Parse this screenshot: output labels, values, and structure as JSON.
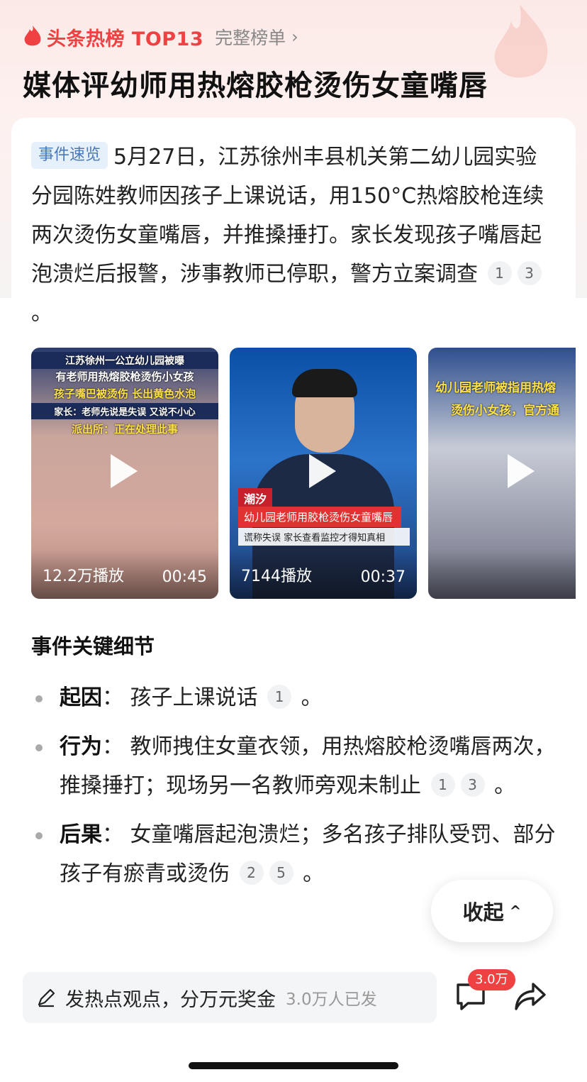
{
  "header": {
    "hot_title": "头条热榜 TOP13",
    "full_list": "完整榜单",
    "headline": "媒体评幼师用热熔胶枪烫伤女童嘴唇"
  },
  "summary": {
    "tag": "事件速览",
    "text": "5月27日，江苏徐州丰县机关第二幼儿园实验分园陈姓教师因孩子上课说话，用150°C热熔胶枪连续两次烫伤女童嘴唇，并推搡捶打。家长发现孩子嘴唇起泡溃烂后报警，涉事教师已停职，警方立案调查",
    "citations": [
      "1",
      "3"
    ],
    "end": "。"
  },
  "videos": [
    {
      "caption_lines": [
        "江苏徐州一公立幼儿园被曝",
        "有老师用热熔胶枪烫伤小女孩",
        "孩子嘴巴被烫伤 长出黄色水泡",
        "家长：老师先说是失误 又说不小心",
        "派出所：正在处理此事"
      ],
      "views": "12.2万播放",
      "duration": "00:45"
    },
    {
      "news_tag": "潮汐",
      "news_bar": "幼儿园老师用胶枪烫伤女童嘴唇",
      "news_sub": "谎称失误 家长查看监控才得知真相",
      "views": "7144播放",
      "duration": "00:37"
    },
    {
      "caption_lines": [
        "幼儿园老师被指用热熔",
        "烫伤小女孩，官方通"
      ],
      "views": "",
      "duration": ""
    }
  ],
  "section_title": "事件关键细节",
  "details": [
    {
      "label": "起因",
      "sep": "：",
      "text": "孩子上课说话",
      "citations": [
        "1"
      ],
      "end": "。"
    },
    {
      "label": "行为",
      "sep": "：",
      "text": "教师拽住女童衣领，用热熔胶枪烫嘴唇两次，推搡捶打；现场另一名教师旁观未制止",
      "citations": [
        "1",
        "3"
      ],
      "end": "。"
    },
    {
      "label": "后果",
      "sep": "：",
      "text": "女童嘴唇起泡溃烂；多名孩子排队受罚、部分孩子有瘀青或烫伤",
      "citations": [
        "2",
        "5"
      ],
      "end": "。"
    }
  ],
  "collapse_label": "收起",
  "bottom": {
    "post_text": "发热点观点，分万元奖金",
    "post_count": "3.0万人已发",
    "comment_badge": "3.0万"
  },
  "colors": {
    "accent": "#f04142",
    "tag_bg": "#e6f0fb",
    "tag_text": "#4a79b8"
  },
  "icons": [
    "flame-icon",
    "chevron-right-icon",
    "play-icon",
    "chevron-up-icon",
    "pen-icon",
    "comment-icon",
    "share-icon"
  ]
}
